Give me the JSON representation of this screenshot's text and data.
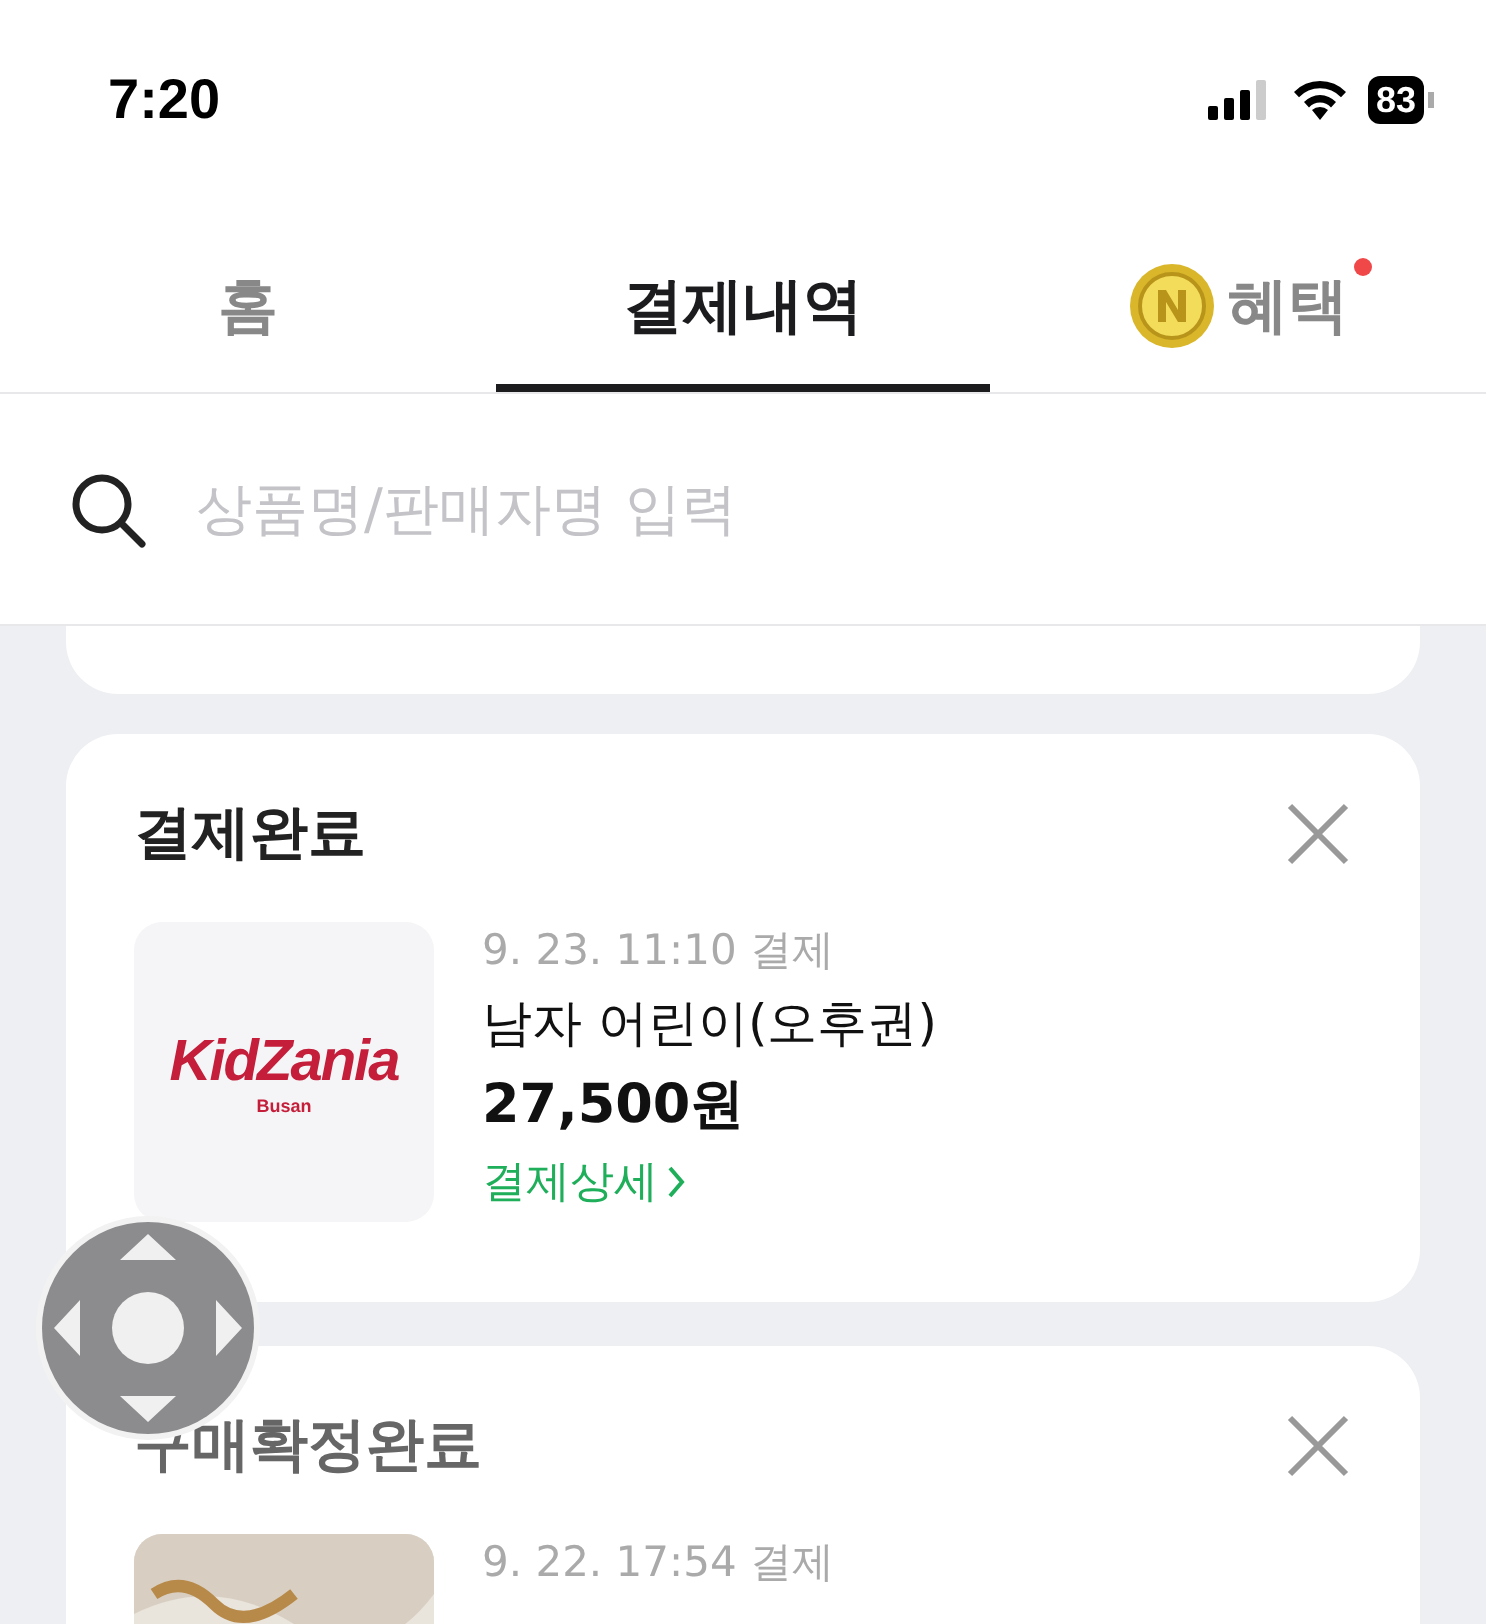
{
  "status_bar": {
    "time": "7:20",
    "battery": "83"
  },
  "tabs": [
    {
      "label": "홈",
      "selected": false,
      "kind": "text",
      "dot": false
    },
    {
      "label": "결제내역",
      "selected": true,
      "kind": "text",
      "dot": false
    },
    {
      "label": "혜택",
      "selected": false,
      "kind": "coin",
      "dot": true
    }
  ],
  "search": {
    "placeholder": "상품명/판매자명 입력"
  },
  "orders": [
    {
      "status": "결제완료",
      "date": "9. 23. 11:10 결제",
      "product": "남자 어린이(오후권)",
      "price": "27,500원",
      "link": "결제상세",
      "thumb": {
        "kind": "logo",
        "logo_text": "KidZania",
        "logo_sub": "Busan"
      }
    },
    {
      "status": "구매확정완료",
      "date": "9. 22. 17:54 결제"
    }
  ]
}
